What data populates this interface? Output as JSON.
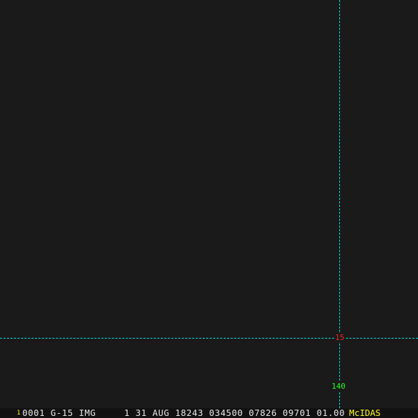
{
  "overlay": {
    "latitude_label": "15",
    "longitude_label": "140"
  },
  "status_bar": {
    "frame_number": "1",
    "info": "0001 G-15 IMG     1 31 AUG 18243 034500 07826 09701 01.00",
    "logo": "McIDAS"
  },
  "colors": {
    "grid": "#00e5e5",
    "latitude": "#ff2020",
    "longitude": "#20ff20",
    "logo": "#ffff00"
  }
}
